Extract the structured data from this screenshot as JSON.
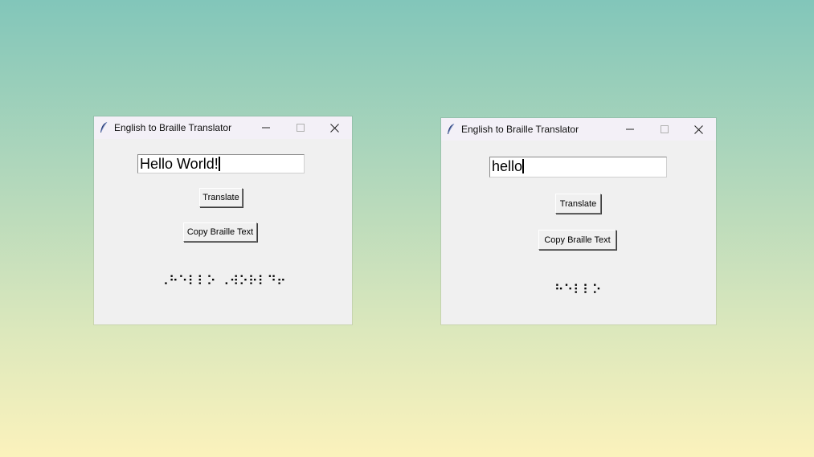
{
  "windows": [
    {
      "title": "English to Braille Translator",
      "input_value": "Hello World!",
      "translate_label": "Translate",
      "copy_label": "Copy Braille Text",
      "braille_output": "⠠⠓⠑⠇⠇⠕ ⠠⠺⠕⠗⠇⠙⠖",
      "controls": {
        "minimize": "─",
        "maximize": "□",
        "close": "✕"
      }
    },
    {
      "title": "English to Braille Translator",
      "input_value": "hello",
      "translate_label": "Translate",
      "copy_label": "Copy Braille Text",
      "braille_output": "⠓⠑⠇⠇⠕",
      "controls": {
        "minimize": "─",
        "maximize": "□",
        "close": "✕"
      }
    }
  ],
  "icons": {
    "app": "feather-icon",
    "minimize": "minimize-icon",
    "maximize": "maximize-icon",
    "close": "close-icon"
  },
  "colors": {
    "window_bg": "#f0f0f0",
    "titlebar_bg": "#f3f0f7",
    "app_icon": "#2b3f7a"
  }
}
